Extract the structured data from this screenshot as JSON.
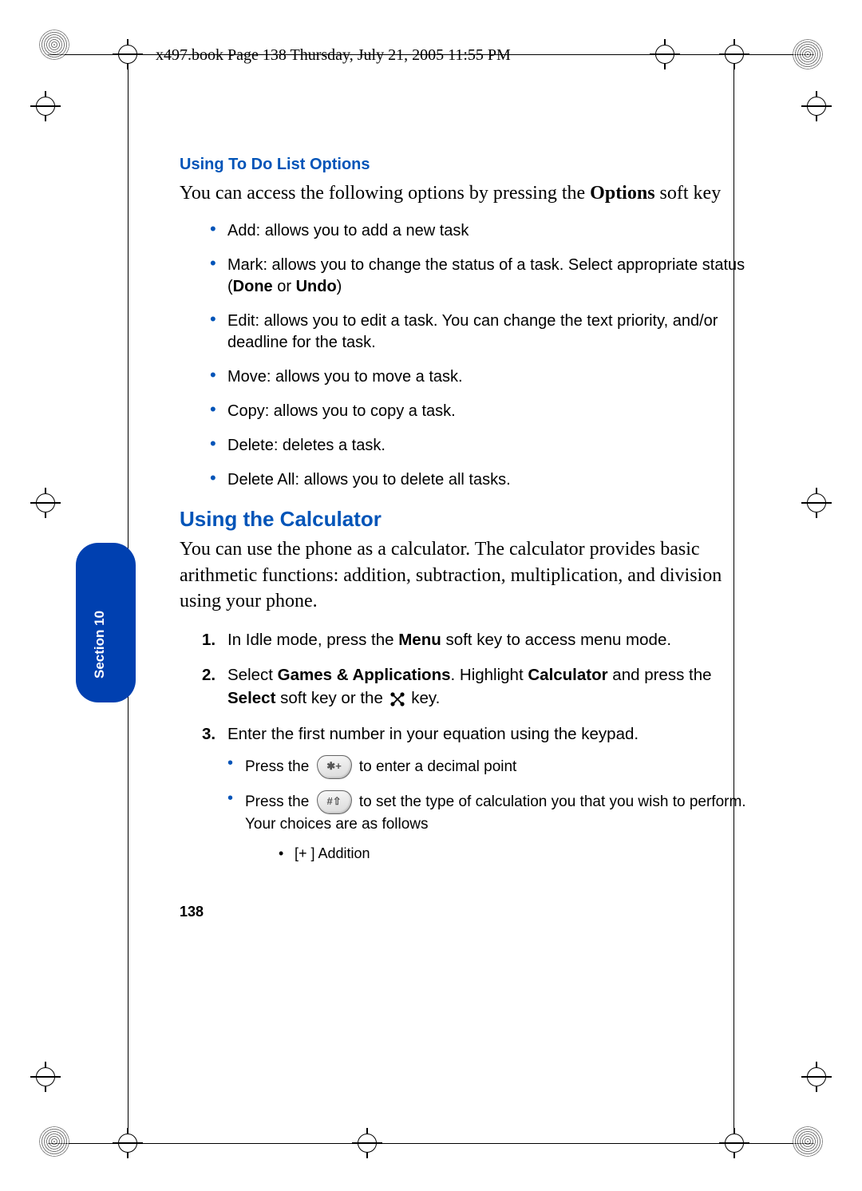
{
  "header": "x497.book  Page 138  Thursday, July 21, 2005  11:55 PM",
  "subheading_1": "Using To Do List Options",
  "intro_1_a": "You can access the following options by pressing the ",
  "intro_1_b": "Options",
  "intro_1_c": " soft key",
  "bullets": [
    "Add: allows you to add a new task",
    "Mark: allows you to change the status of a task. Select appropriate status (<b>Done</b> or <b>Undo</b>)",
    "Edit: allows you to edit a task. You can change the text priority, and/or deadline for the task.",
    "Move: allows you to move a task.",
    "Copy: allows you to copy a task.",
    "Delete: deletes a task.",
    "Delete All: allows you to delete all tasks."
  ],
  "heading_2": "Using the Calculator",
  "intro_2": "You can use the phone as a calculator. The calculator provides basic arithmetic functions: addition, subtraction, multiplication, and division using your phone.",
  "steps": [
    "In Idle mode, press the <b>Menu</b> soft key to access menu mode.",
    "Select <b>Games & Applications</b>. Highlight <b>Calculator</b> and press the <b>Select</b> soft key or the {XICON} key.",
    "Enter the first number in your equation using the keypad."
  ],
  "sub_bullets": [
    "Press the {KEY_STAR} to enter a decimal point",
    "Press the {KEY_HASH} to set the type of calculation you that you wish to perform. Your choices are as follows"
  ],
  "sub_sub": "[+  ] Addition",
  "section_label": "Section 10",
  "page_number": "138",
  "key_star_label": "✱+",
  "key_hash_label": "#⇧"
}
